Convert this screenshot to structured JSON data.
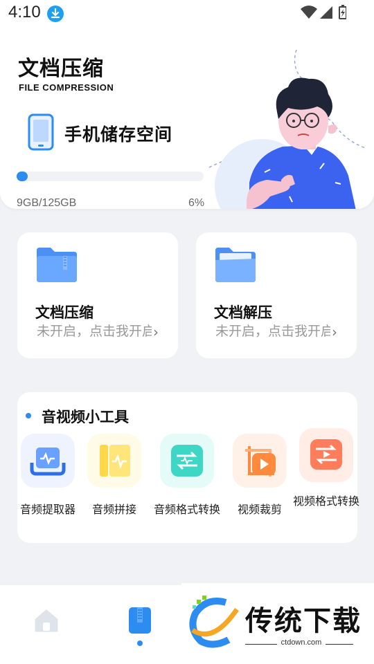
{
  "status_bar": {
    "time": "4:10"
  },
  "header": {
    "title": "文档压缩",
    "subtitle": "FILE COMPRESSION",
    "storage_label": "手机储存空间",
    "storage_amount": "9GB/125GB",
    "storage_percent": "6%",
    "storage_fraction": 0.06
  },
  "features": [
    {
      "title": "文档压缩",
      "status": "未开启，点击我开启"
    },
    {
      "title": "文档解压",
      "status": "未开启，点击我开启"
    }
  ],
  "tools": {
    "title": "音视频小工具",
    "items": [
      {
        "label": "音频提取器",
        "icon": "audio-extract-icon"
      },
      {
        "label": "音频拼接",
        "icon": "audio-merge-icon"
      },
      {
        "label": "音频格式转换",
        "icon": "audio-convert-icon"
      },
      {
        "label": "视频裁剪",
        "icon": "video-crop-icon"
      },
      {
        "label": "视频格式转换",
        "icon": "video-convert-icon"
      }
    ]
  },
  "bottom_nav": {
    "items": [
      {
        "icon": "home-icon",
        "active": false
      },
      {
        "icon": "zip-file-icon",
        "active": true
      }
    ]
  },
  "watermark": {
    "text": "传统下载",
    "url": "ctdown.com"
  },
  "colors": {
    "accent": "#2d8cf0",
    "page_bg": "#f1f2f6"
  }
}
